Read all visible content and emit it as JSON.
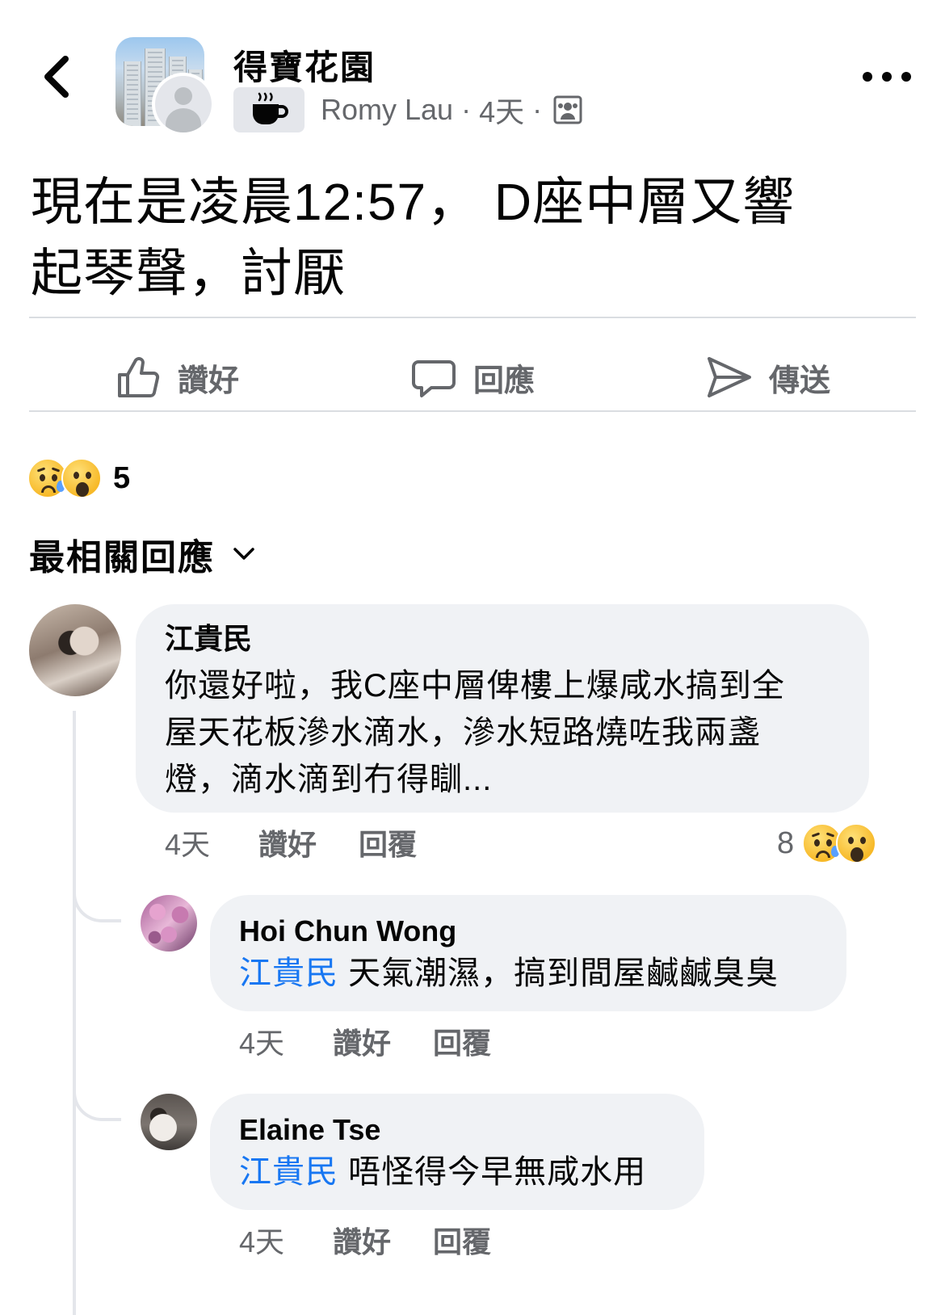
{
  "header": {
    "group_name": "得寶花園",
    "author": "Romy Lau",
    "separator": "·",
    "time": "4天"
  },
  "post": {
    "line1": "現在是凌晨12:57， D座中層又響",
    "line2": "起琴聲，討厭"
  },
  "actions": {
    "like": "讚好",
    "comment": "回應",
    "send": "傳送"
  },
  "reactions": {
    "count": "5"
  },
  "sort": {
    "label": "最相關回應"
  },
  "comments": [
    {
      "author": "江貴民",
      "lines": [
        "你還好啦，我C座中層俾樓上爆咸水搞到全",
        "屋天花板滲水滴水，滲水短路燒咗我兩盞",
        "燈，滴水滴到冇得瞓..."
      ],
      "time": "4天",
      "like": "讚好",
      "reply": "回覆",
      "reaction_count": "8"
    },
    {
      "author": "Hoi Chun Wong",
      "mention": "江貴民",
      "text": " 天氣潮濕，搞到間屋鹹鹹臭臭",
      "time": "4天",
      "like": "讚好",
      "reply": "回覆"
    },
    {
      "author": "Elaine  Tse",
      "mention": "江貴民",
      "text": " 唔怪得今早無咸水用",
      "time": "4天",
      "like": "讚好",
      "reply": "回覆"
    }
  ],
  "colors": {
    "mention": "#1877f2",
    "secondary_text": "#65676b",
    "bubble": "#f0f2f5"
  }
}
